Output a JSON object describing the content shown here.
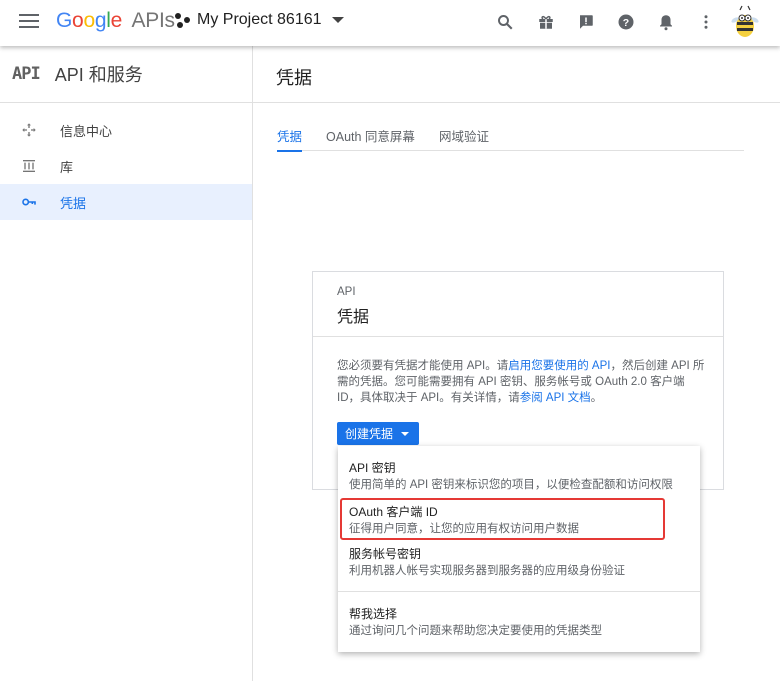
{
  "header": {
    "logo_google": "Google",
    "logo_apis": "APIs",
    "project_name": "My Project 86161",
    "icons": [
      "menu-icon",
      "search-icon",
      "gift-icon",
      "feedback-icon",
      "help-icon",
      "notifications-icon",
      "more-vert-icon",
      "avatar"
    ]
  },
  "sidebar": {
    "api_logo": "API",
    "title": "API 和服务",
    "items": [
      {
        "label": "信息中心",
        "icon": "dashboard-icon",
        "active": false
      },
      {
        "label": "库",
        "icon": "library-icon",
        "active": false
      },
      {
        "label": "凭据",
        "icon": "key-icon",
        "active": true
      }
    ]
  },
  "main": {
    "title": "凭据",
    "tabs": [
      {
        "label": "凭据",
        "active": true
      },
      {
        "label": "OAuth 同意屏幕",
        "active": false
      },
      {
        "label": "网域验证",
        "active": false
      }
    ]
  },
  "card": {
    "kicker": "API",
    "title": "凭据",
    "desc_1": "您必须要有凭据才能使用 API。请",
    "desc_link_1": "启用您要使用的 API",
    "desc_2": "，然后创建 API 所需的凭据。您可能需要拥有 API 密钥、服务帐号或 OAuth 2.0 客户端 ID，具体取决于 API。有关详情，请",
    "desc_link_2": "参阅 API 文档",
    "desc_3": "。",
    "button": "创建凭据"
  },
  "menu": {
    "items": [
      {
        "title": "API 密钥",
        "desc": "使用简单的 API 密钥来标识您的项目，以便检查配额和访问权限"
      },
      {
        "title": "OAuth 客户端 ID",
        "desc": "征得用户同意，让您的应用有权访问用户数据"
      },
      {
        "title": "服务帐号密钥",
        "desc": "利用机器人帐号实现服务器到服务器的应用级身份验证"
      },
      {
        "title": "帮我选择",
        "desc": "通过询问几个问题来帮助您决定要使用的凭据类型"
      }
    ]
  },
  "colors": {
    "accent": "#1a73e8",
    "highlight": "#e53935",
    "active_bg": "#e8f0fe"
  }
}
